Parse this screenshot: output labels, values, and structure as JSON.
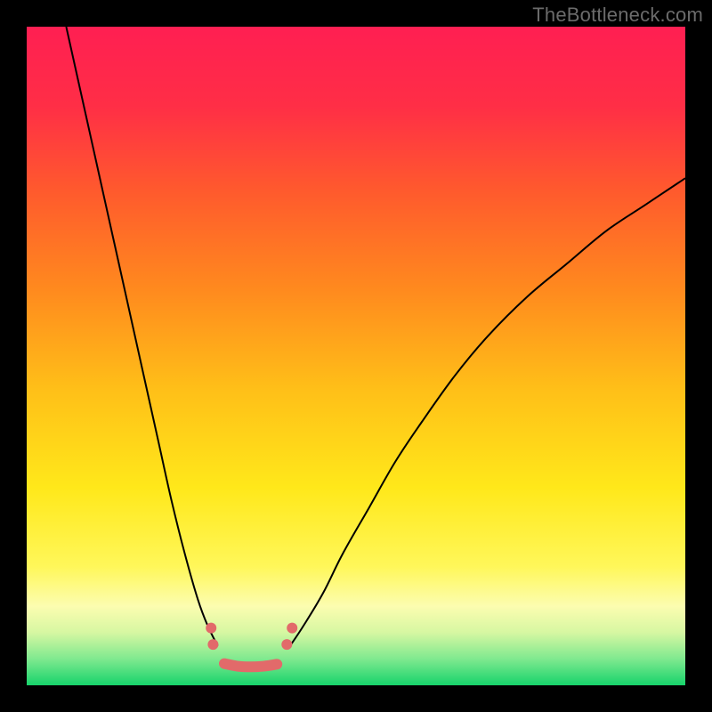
{
  "watermark": "TheBottleneck.com",
  "gradient_stops": [
    {
      "offset": 0.0,
      "color": "#ff1f52"
    },
    {
      "offset": 0.12,
      "color": "#ff2e46"
    },
    {
      "offset": 0.25,
      "color": "#ff5a2d"
    },
    {
      "offset": 0.4,
      "color": "#ff8a1e"
    },
    {
      "offset": 0.55,
      "color": "#ffbf18"
    },
    {
      "offset": 0.7,
      "color": "#ffe81a"
    },
    {
      "offset": 0.82,
      "color": "#fff75a"
    },
    {
      "offset": 0.88,
      "color": "#fcfdb0"
    },
    {
      "offset": 0.92,
      "color": "#d6f7a2"
    },
    {
      "offset": 0.96,
      "color": "#7fe98f"
    },
    {
      "offset": 1.0,
      "color": "#17d36b"
    }
  ],
  "chart_data": {
    "type": "line",
    "title": "",
    "xlabel": "",
    "ylabel": "",
    "xlim": [
      0,
      100
    ],
    "ylim": [
      0,
      100
    ],
    "grid": false,
    "series": [
      {
        "name": "left-branch",
        "color": "#000000",
        "stroke_width": 2.0,
        "x": [
          6,
          8,
          10,
          12,
          14,
          16,
          18,
          20,
          22,
          24,
          26,
          27.5,
          29
        ],
        "y": [
          100,
          91,
          82,
          73,
          64,
          55,
          46,
          37,
          28,
          20,
          13,
          9,
          6
        ]
      },
      {
        "name": "right-branch",
        "color": "#000000",
        "stroke_width": 2.0,
        "x": [
          40,
          42,
          45,
          48,
          52,
          56,
          60,
          65,
          70,
          76,
          82,
          88,
          94,
          100
        ],
        "y": [
          6,
          9,
          14,
          20,
          27,
          34,
          40,
          47,
          53,
          59,
          64,
          69,
          73,
          77
        ]
      },
      {
        "name": "valley-floor",
        "color": "#e26a6a",
        "stroke_width": 12,
        "linecap": "round",
        "x": [
          30,
          32,
          34,
          36,
          38
        ],
        "y": [
          3.3,
          2.9,
          2.8,
          2.9,
          3.2
        ]
      }
    ],
    "markers": [
      {
        "name": "left-dot-upper",
        "x": 28.0,
        "y": 8.7,
        "r": 6,
        "color": "#e26a6a"
      },
      {
        "name": "left-dot-lower",
        "x": 28.3,
        "y": 6.2,
        "r": 6,
        "color": "#e26a6a"
      },
      {
        "name": "right-dot-lower",
        "x": 39.5,
        "y": 6.2,
        "r": 6,
        "color": "#e26a6a"
      },
      {
        "name": "right-dot-upper",
        "x": 40.3,
        "y": 8.7,
        "r": 6,
        "color": "#e26a6a"
      }
    ]
  }
}
